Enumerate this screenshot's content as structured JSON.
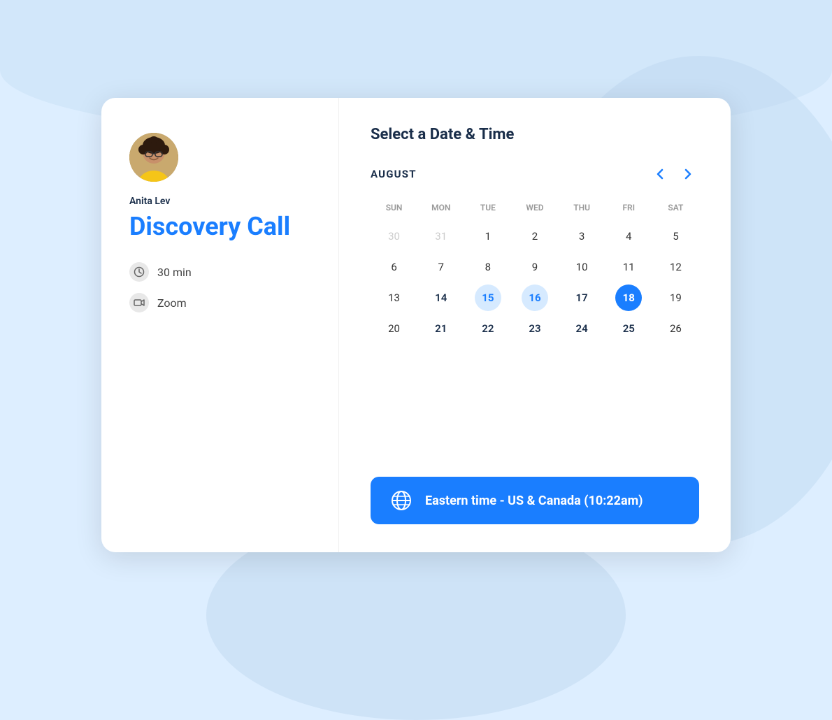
{
  "background": {
    "color": "#cce0f5"
  },
  "card": {
    "left_panel": {
      "host_name": "Anita Lev",
      "event_title": "Discovery Call",
      "details": [
        {
          "id": "duration",
          "icon": "clock-icon",
          "text": "30 min"
        },
        {
          "id": "platform",
          "icon": "video-icon",
          "text": "Zoom"
        }
      ]
    },
    "right_panel": {
      "section_title": "Select a Date & Time",
      "calendar": {
        "month_label": "AUGUST",
        "day_headers": [
          "SUN",
          "MON",
          "TUE",
          "WED",
          "THU",
          "FRI",
          "SAT"
        ],
        "weeks": [
          [
            {
              "day": 30,
              "state": "other-month"
            },
            {
              "day": 31,
              "state": "other-month"
            },
            {
              "day": 1,
              "state": "normal"
            },
            {
              "day": 2,
              "state": "normal"
            },
            {
              "day": 3,
              "state": "normal"
            },
            {
              "day": 4,
              "state": "normal"
            },
            {
              "day": 5,
              "state": "normal"
            }
          ],
          [
            {
              "day": 6,
              "state": "normal"
            },
            {
              "day": 7,
              "state": "normal"
            },
            {
              "day": 8,
              "state": "normal"
            },
            {
              "day": 9,
              "state": "normal"
            },
            {
              "day": 10,
              "state": "normal"
            },
            {
              "day": 11,
              "state": "normal"
            },
            {
              "day": 12,
              "state": "normal"
            }
          ],
          [
            {
              "day": 13,
              "state": "normal"
            },
            {
              "day": 14,
              "state": "available"
            },
            {
              "day": 15,
              "state": "highlighted"
            },
            {
              "day": 16,
              "state": "highlighted"
            },
            {
              "day": 17,
              "state": "available"
            },
            {
              "day": 18,
              "state": "selected"
            },
            {
              "day": 19,
              "state": "normal"
            }
          ],
          [
            {
              "day": 20,
              "state": "normal"
            },
            {
              "day": 21,
              "state": "available"
            },
            {
              "day": 22,
              "state": "available"
            },
            {
              "day": 23,
              "state": "available"
            },
            {
              "day": 24,
              "state": "available"
            },
            {
              "day": 25,
              "state": "available"
            },
            {
              "day": 26,
              "state": "normal"
            }
          ]
        ]
      },
      "timezone": {
        "label": "Eastern time - US & Canada (10:22am)"
      }
    }
  },
  "nav": {
    "prev_label": "‹",
    "next_label": "›"
  }
}
